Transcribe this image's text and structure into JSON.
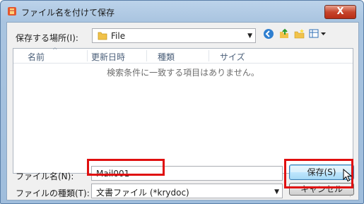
{
  "window": {
    "title": "ファイル名を付けて保存",
    "close_label": "X"
  },
  "save_in": {
    "label": "保存する場所(I):",
    "value": "File"
  },
  "columns": [
    "名前",
    "更新日時",
    "種類",
    "サイズ"
  ],
  "empty_message": "検索条件に一致する項目はありません。",
  "file_name": {
    "label": "ファイル名(N):",
    "value": "Mail001"
  },
  "file_type": {
    "label": "ファイルの種類(T):",
    "value": "文書ファイル (*krydoc)"
  },
  "buttons": {
    "save": "保存(S)",
    "cancel": "キャンセル"
  },
  "colors": {
    "highlight": "#e01010",
    "accent": "#3c7fb1"
  }
}
